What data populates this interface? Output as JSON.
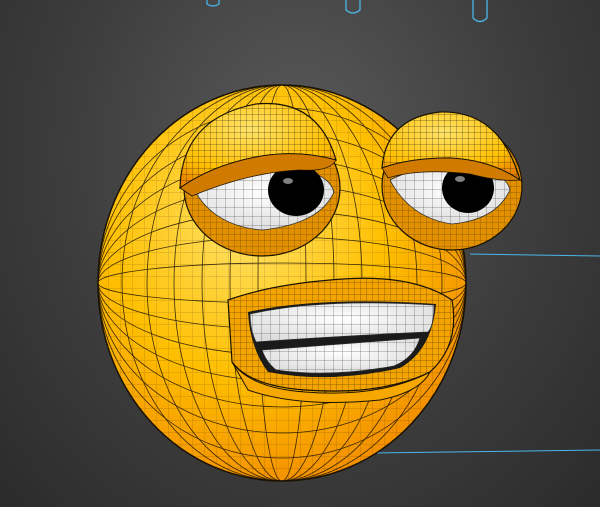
{
  "viewport": {
    "background_color": "#3f3f3f",
    "background_edge_color": "#2b2b2b",
    "guide_color": "#4ab6e8"
  },
  "model": {
    "skin_color": "#ffbf00",
    "skin_highlight_color": "#ffe36a",
    "skin_shadow_color": "#f28c00",
    "wire_color": "#1a1200",
    "eye_white_color": "#ffffff",
    "pupil_color": "#000000",
    "teeth_color": "#ffffff",
    "mouth_interior_color": "#1a1a1a",
    "eye_count": 2,
    "overhead_light_markers": 3
  }
}
